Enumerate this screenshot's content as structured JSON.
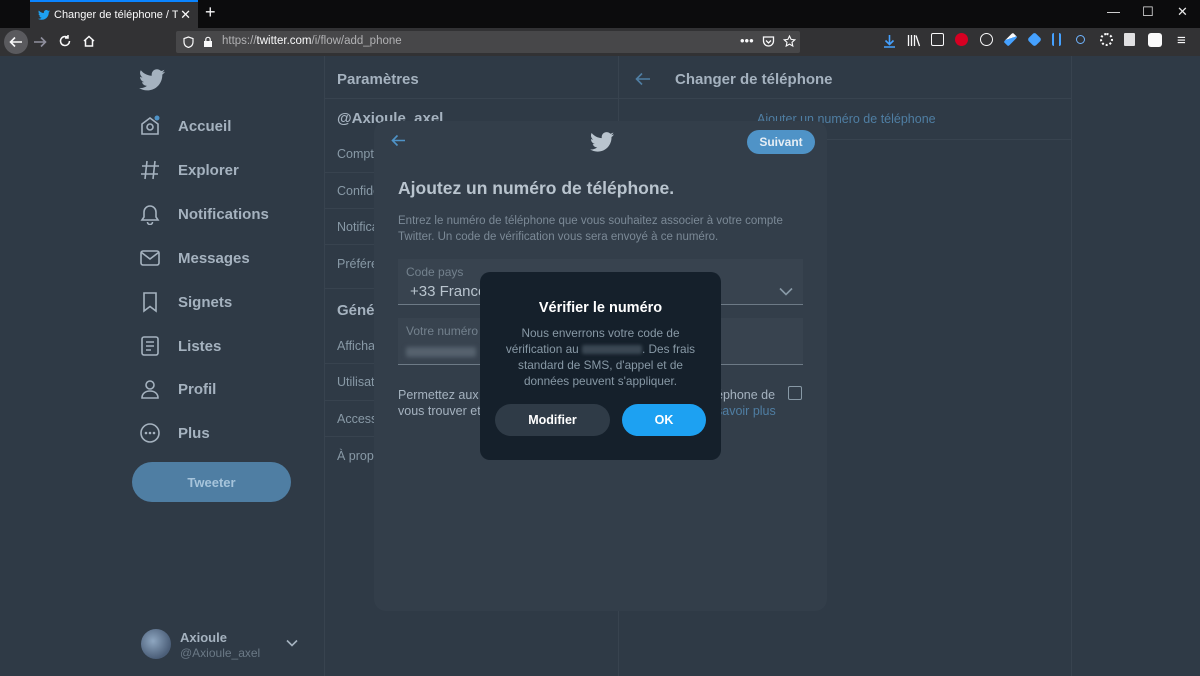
{
  "browser": {
    "tab_title": "Changer de téléphone / Twitter",
    "url_prefix": "https://",
    "url_host": "twitter.com",
    "url_path": "/i/flow/add_phone"
  },
  "sidebar": {
    "items": [
      {
        "label": "Accueil",
        "icon": "home-icon"
      },
      {
        "label": "Explorer",
        "icon": "hashtag-icon"
      },
      {
        "label": "Notifications",
        "icon": "bell-icon"
      },
      {
        "label": "Messages",
        "icon": "envelope-icon"
      },
      {
        "label": "Signets",
        "icon": "bookmark-icon"
      },
      {
        "label": "Listes",
        "icon": "list-icon"
      },
      {
        "label": "Profil",
        "icon": "person-icon"
      },
      {
        "label": "Plus",
        "icon": "more-icon"
      }
    ],
    "tweet_button": "Tweeter",
    "account": {
      "name": "Axioule",
      "handle": "@Axioule_axel"
    }
  },
  "settings": {
    "header": "Paramètres",
    "user": "@Axioule_axel",
    "items": [
      "Compt",
      "Confide",
      "Notifica",
      "Préfére"
    ],
    "section": "Géné",
    "items2": [
      "Affichag",
      "Utilisat",
      "Accessi",
      "À propo"
    ]
  },
  "right_panel": {
    "title": "Changer de téléphone",
    "link": "Ajouter un numéro de téléphone"
  },
  "modal": {
    "next_button": "Suivant",
    "title": "Ajoutez un numéro de téléphone.",
    "description": "Entrez le numéro de téléphone que vous souhaitez associer à votre compte Twitter. Un code de vérification vous sera envoyé à ce numéro.",
    "country_label": "Code pays",
    "country_value": "+33 France",
    "number_label": "Votre numéro",
    "permission_left_1": "Permettez aux p",
    "permission_left_2": "vous trouver et",
    "permission_right_1": "éphone de",
    "permission_right_2": "savoir plus"
  },
  "dialog": {
    "title": "Vérifier le numéro",
    "body_1": "Nous enverrons votre code de vérification au",
    "body_2": ". Des frais standard de SMS, d'appel et de données peuvent s'appliquer.",
    "modify_button": "Modifier",
    "ok_button": "OK"
  },
  "colors": {
    "accent": "#1da1f2",
    "background_dim": "#2f3a46",
    "dialog_bg": "#15202b"
  }
}
